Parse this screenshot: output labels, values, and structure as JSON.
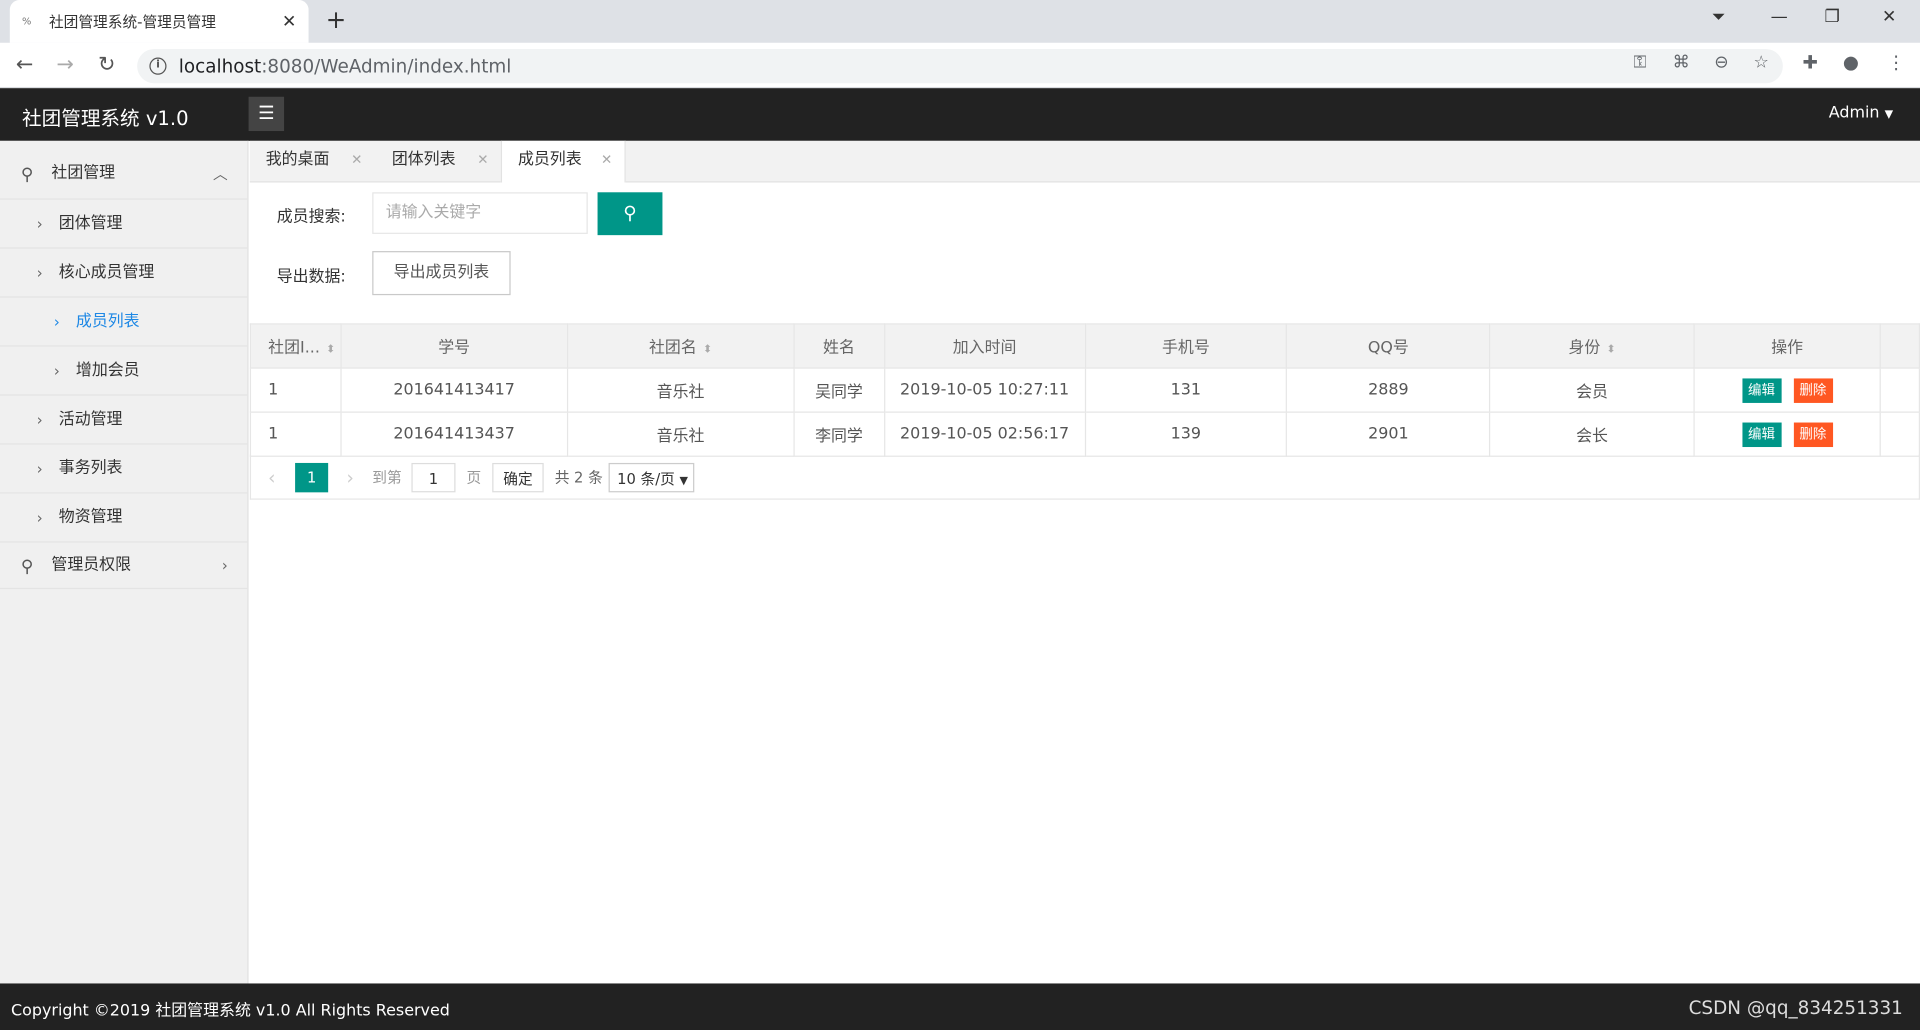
{
  "browser": {
    "tab_title": "社团管理系统-管理员管理",
    "url_host": "localhost",
    "url_path": ":8080/WeAdmin/index.html"
  },
  "header": {
    "app_title": "社团管理系统 v1.0",
    "user": "Admin"
  },
  "sidebar": {
    "group1": "社团管理",
    "items": [
      "团体管理",
      "核心成员管理",
      "成员列表",
      "增加会员",
      "活动管理",
      "事务列表",
      "物资管理"
    ],
    "group2": "管理员权限"
  },
  "tabs": [
    "我的桌面",
    "团体列表",
    "成员列表"
  ],
  "search": {
    "label": "成员搜索:",
    "placeholder": "请输入关键字"
  },
  "export": {
    "label": "导出数据:",
    "button": "导出成员列表"
  },
  "table": {
    "columns": [
      "社团I...",
      "学号",
      "社团名",
      "姓名",
      "加入时间",
      "手机号",
      "QQ号",
      "身份",
      "操作"
    ],
    "rows": [
      {
        "club_id": "1",
        "student_no": "201641413417",
        "club": "音乐社",
        "name": "吴同学",
        "joined": "2019-10-05 10:27:11",
        "phone": "131",
        "qq": "2889",
        "role": "会员"
      },
      {
        "club_id": "1",
        "student_no": "201641413437",
        "club": "音乐社",
        "name": "李同学",
        "joined": "2019-10-05 02:56:17",
        "phone": "139",
        "qq": "2901",
        "role": "会长"
      }
    ],
    "edit_label": "编辑",
    "delete_label": "删除"
  },
  "pager": {
    "current": "1",
    "goto_label": "到第",
    "goto_value": "1",
    "page_unit": "页",
    "ok": "确定",
    "total": "共 2 条",
    "per_page": "10 条/页"
  },
  "footer": {
    "copyright": "Copyright ©2019 社团管理系统 v1.0 All Rights Reserved",
    "watermark": "CSDN @qq_834251331"
  },
  "colors": {
    "accent": "#009688",
    "danger": "#ff5722",
    "header_bg": "#222222",
    "active_link": "#1e88e5"
  }
}
